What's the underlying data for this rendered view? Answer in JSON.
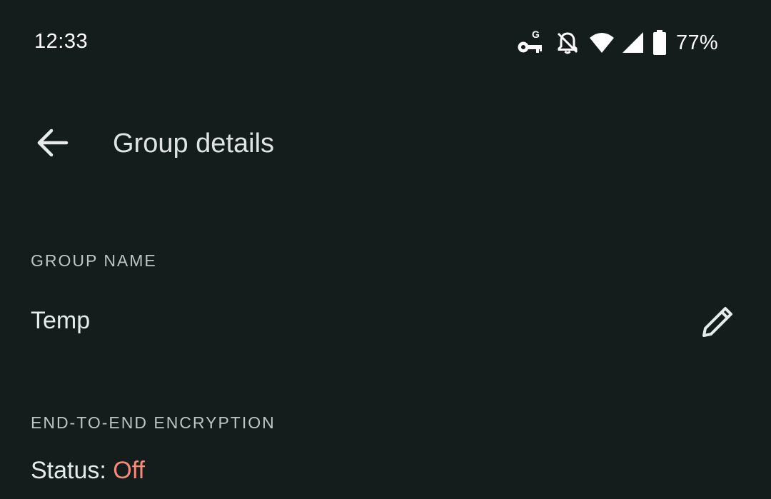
{
  "status_bar": {
    "time": "12:33",
    "battery_percent": "77%",
    "icons": [
      "vpn-key-icon",
      "notifications-off-icon",
      "wifi-icon",
      "cell-signal-icon",
      "battery-icon"
    ]
  },
  "app_bar": {
    "back_icon": "arrow-back-icon",
    "title": "Group details"
  },
  "group_name": {
    "label": "GROUP NAME",
    "value": "Temp",
    "edit_icon": "pencil-icon"
  },
  "encryption": {
    "label": "END-TO-END ENCRYPTION",
    "status_prefix": "Status: ",
    "status_value": "Off",
    "status_color": "#f28b78"
  },
  "colors": {
    "background": "#141d1c",
    "text_primary": "#e6ebe9",
    "text_secondary": "#bcc5c2"
  }
}
